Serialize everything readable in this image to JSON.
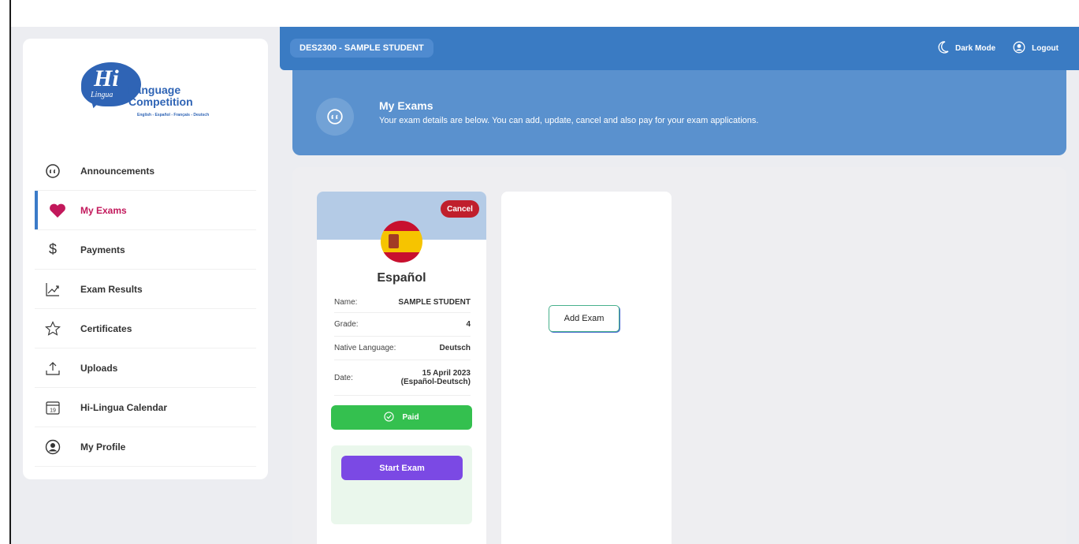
{
  "header": {
    "user": "DES2300 - SAMPLE STUDENT",
    "dark_mode_label": "Dark Mode",
    "logout_label": "Logout"
  },
  "logo": {
    "hi": "Hi",
    "lingua": "Lingua",
    "line1": "Language",
    "line2": "Competition",
    "tagline": "English - Español - Français - Deutsch"
  },
  "sidebar": {
    "items": [
      {
        "label": "Announcements",
        "icon": "quote-bubble-icon"
      },
      {
        "label": "My Exams",
        "icon": "heart-icon",
        "active": true
      },
      {
        "label": "Payments",
        "icon": "dollar-icon"
      },
      {
        "label": "Exam Results",
        "icon": "trend-chart-icon"
      },
      {
        "label": "Certificates",
        "icon": "star-icon"
      },
      {
        "label": "Uploads",
        "icon": "upload-icon"
      },
      {
        "label": "Hi-Lingua Calendar",
        "icon": "calendar-icon",
        "calendar_day": "19"
      },
      {
        "label": "My Profile",
        "icon": "user-circle-icon"
      }
    ]
  },
  "banner": {
    "title": "My Exams",
    "subtitle": "Your exam details are below. You can add, update, cancel and also pay for your exam applications."
  },
  "exam": {
    "cancel_label": "Cancel",
    "language": "Español",
    "fields": [
      {
        "key": "Name:",
        "value": "SAMPLE STUDENT"
      },
      {
        "key": "Grade:",
        "value": "4"
      },
      {
        "key": "Native Language:",
        "value": "Deutsch"
      },
      {
        "key": "Date:",
        "value": "15 April 2023",
        "value2": "(Español-Deutsch)"
      }
    ],
    "status_label": "Paid",
    "start_label": "Start Exam"
  },
  "add_exam_label": "Add Exam",
  "colors": {
    "topbar": "#3a7bc3",
    "banner": "#5a91ce",
    "active_accent": "#c2185b",
    "paid": "#34c04f",
    "start": "#7b49e4",
    "cancel": "#c01f2c"
  }
}
